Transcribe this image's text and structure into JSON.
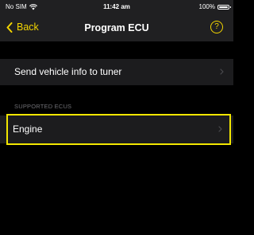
{
  "status_bar": {
    "carrier": "No SIM",
    "time": "11:42 am",
    "battery": "100%",
    "battery_level": 1.0
  },
  "nav": {
    "back_label": "Back",
    "title": "Program ECU",
    "help_label": "?"
  },
  "rows": {
    "send_vehicle_info": "Send vehicle info to tuner"
  },
  "supported_ecus": {
    "header": "SUPPORTED ECUS",
    "items": [
      "Engine"
    ]
  },
  "colors": {
    "accent": "#f2d400",
    "highlight": "#f2e600",
    "background": "#000000",
    "bar": "#202022",
    "cell": "#1c1c1e"
  }
}
